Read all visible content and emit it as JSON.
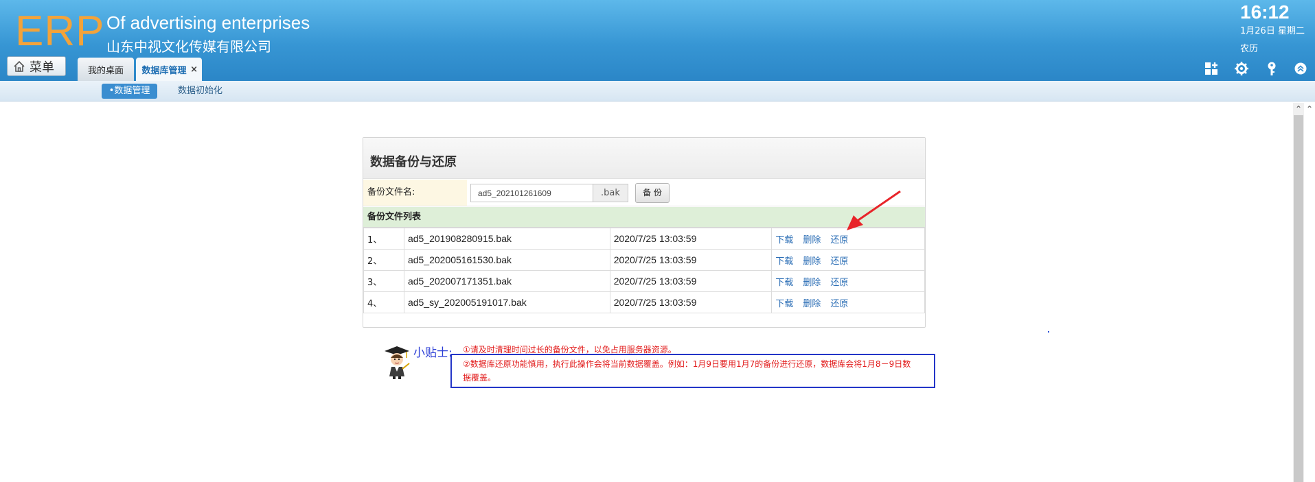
{
  "header": {
    "logo": "ERP",
    "company_en": "Of advertising enterprises",
    "company_cn": "山东中视文化传媒有限公司",
    "time": "16:12",
    "date": "1月26日 星期二",
    "lunar": "农历",
    "menu_label": "菜单",
    "tabs": [
      {
        "label": "我的桌面"
      },
      {
        "label": "数据库管理"
      }
    ],
    "tab_close": "×",
    "brand_color": "#f3a33a"
  },
  "subnav": {
    "items": [
      {
        "label": "•数据管理"
      },
      {
        "label": "数据初始化"
      }
    ]
  },
  "panel": {
    "title": "数据备份与还原",
    "form": {
      "label": "备份文件名:",
      "value": "ad5_202101261609",
      "suffix": ".bak",
      "button": "备 份"
    },
    "list_title": "备份文件列表",
    "files": [
      {
        "index": "1、",
        "name": "ad5_201908280915.bak",
        "time": "2020/7/25 13:03:59"
      },
      {
        "index": "2、",
        "name": "ad5_202005161530.bak",
        "time": "2020/7/25 13:03:59"
      },
      {
        "index": "3、",
        "name": "ad5_202007171351.bak",
        "time": "2020/7/25 13:03:59"
      },
      {
        "index": "4、",
        "name": "ad5_sy_202005191017.bak",
        "time": "2020/7/25 13:03:59"
      }
    ],
    "actions": {
      "download": "下载",
      "delete": "删除",
      "restore": "还原"
    }
  },
  "tips": {
    "label": "小贴士:",
    "line1": "①请及时清理时间过长的备份文件，以免占用服务器资源。",
    "line2": "②数据库还原功能慎用，执行此操作会将当前数据覆盖。例如：1月9日要用1月7的备份进行还原，数据库会将1月8－9日数据覆盖。"
  }
}
